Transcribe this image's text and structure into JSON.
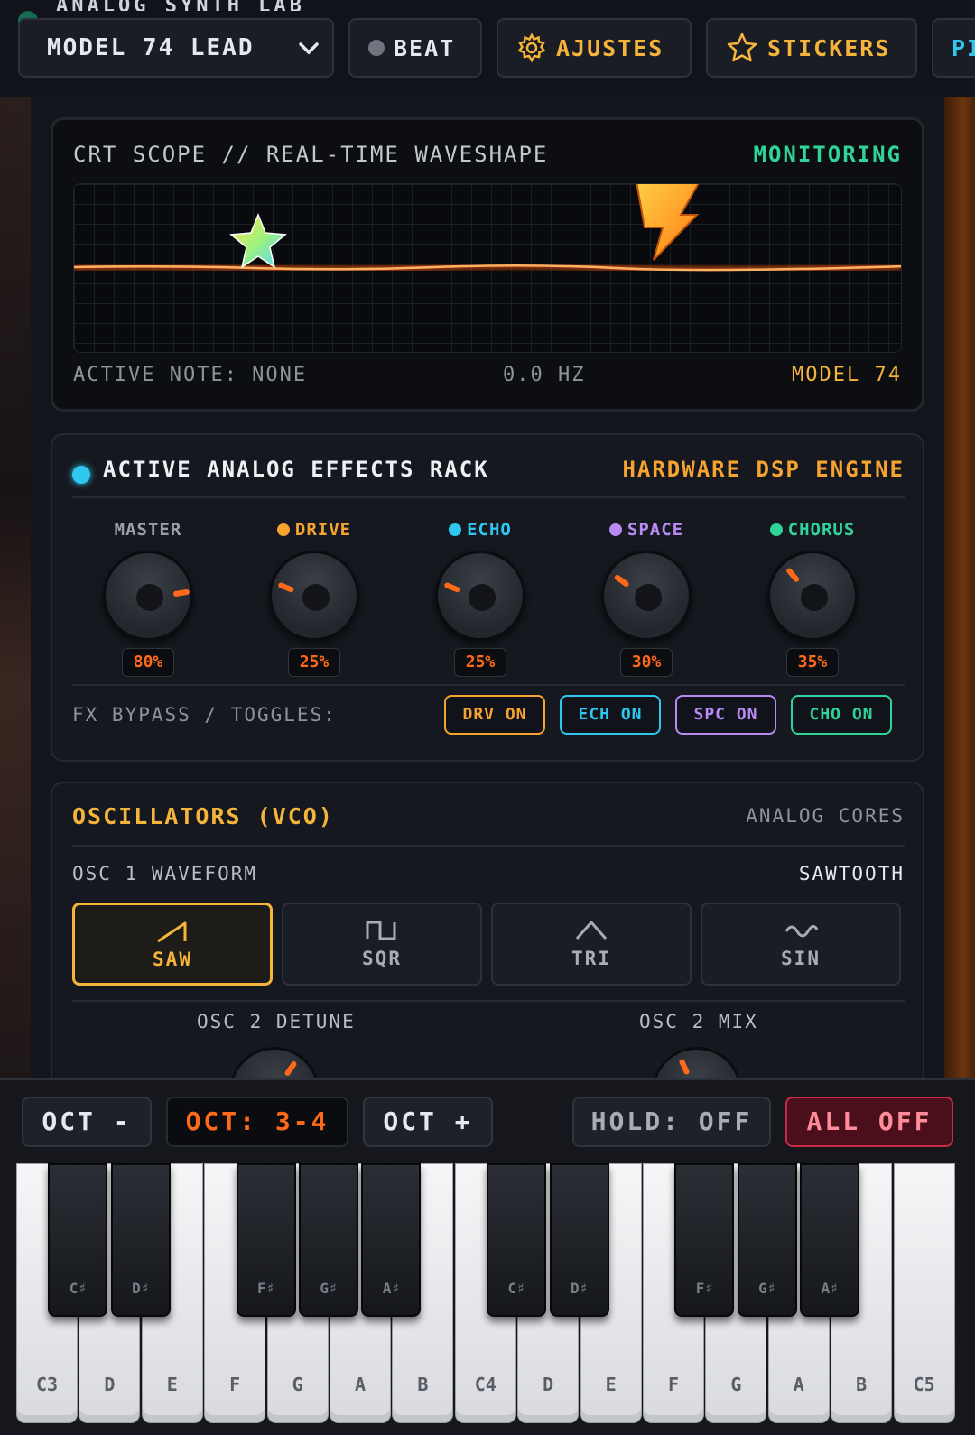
{
  "toolbar": {
    "cut_title": "ANALOG SYNTH LAB",
    "preset": "MODEL 74 LEAD",
    "beat": "BEAT",
    "ajustes": "AJUSTES",
    "stickers": "STICKERS",
    "cut_button": "PI"
  },
  "scope": {
    "title": "CRT SCOPE // REAL-TIME WAVESHAPE",
    "status": "MONITORING",
    "active_note": "ACTIVE NOTE: NONE",
    "frequency": "0.0 HZ",
    "model": "MODEL 74"
  },
  "fx": {
    "title": "ACTIVE ANALOG EFFECTS RACK",
    "engine": "HARDWARE DSP ENGINE",
    "knobs": [
      {
        "label": "MASTER",
        "value": "80%",
        "level": 0.8,
        "color": "#9aa0a8",
        "led": ""
      },
      {
        "label": "DRIVE",
        "value": "25%",
        "level": 0.25,
        "color": "#f6a330",
        "led": "#f6a330"
      },
      {
        "label": "ECHO",
        "value": "25%",
        "level": 0.25,
        "color": "#2fc6f0",
        "led": "#2fc6f0"
      },
      {
        "label": "SPACE",
        "value": "30%",
        "level": 0.3,
        "color": "#b88af5",
        "led": "#b88af5"
      },
      {
        "label": "CHORUS",
        "value": "35%",
        "level": 0.35,
        "color": "#30d39a",
        "led": "#30d39a"
      }
    ],
    "toggles_label": "FX BYPASS / TOGGLES:",
    "toggles": [
      {
        "label": "DRV ON",
        "color": "#f6a330"
      },
      {
        "label": "ECH ON",
        "color": "#2fc6f0"
      },
      {
        "label": "SPC ON",
        "color": "#b88af5"
      },
      {
        "label": "CHO ON",
        "color": "#30d39a"
      }
    ]
  },
  "osc": {
    "title": "OSCILLATORS (VCO)",
    "cores": "ANALOG CORES",
    "osc1_label": "OSC 1 WAVEFORM",
    "osc1_value": "SAWTOOTH",
    "waveforms": [
      {
        "label": "SAW",
        "icon": "saw-wave-icon",
        "selected": true
      },
      {
        "label": "SQR",
        "icon": "square-wave-icon",
        "selected": false
      },
      {
        "label": "TRI",
        "icon": "triangle-wave-icon",
        "selected": false
      },
      {
        "label": "SIN",
        "icon": "sine-wave-icon",
        "selected": false
      }
    ],
    "detune_label": "OSC 2 DETUNE",
    "mix_label": "OSC 2 MIX"
  },
  "keyboard_controls": {
    "oct_down": "OCT -",
    "oct_display": "OCT: 3-4",
    "oct_up": "OCT +",
    "hold": "HOLD: OFF",
    "all_off": "ALL OFF"
  },
  "keyboard": {
    "white_keys": [
      "C3",
      "D",
      "E",
      "F",
      "G",
      "A",
      "B",
      "C4",
      "D",
      "E",
      "F",
      "G",
      "A",
      "B",
      "C5"
    ],
    "black_keys": [
      "C♯",
      "D♯",
      "F♯",
      "G♯",
      "A♯",
      "C♯",
      "D♯",
      "F♯",
      "G♯",
      "A♯"
    ]
  }
}
